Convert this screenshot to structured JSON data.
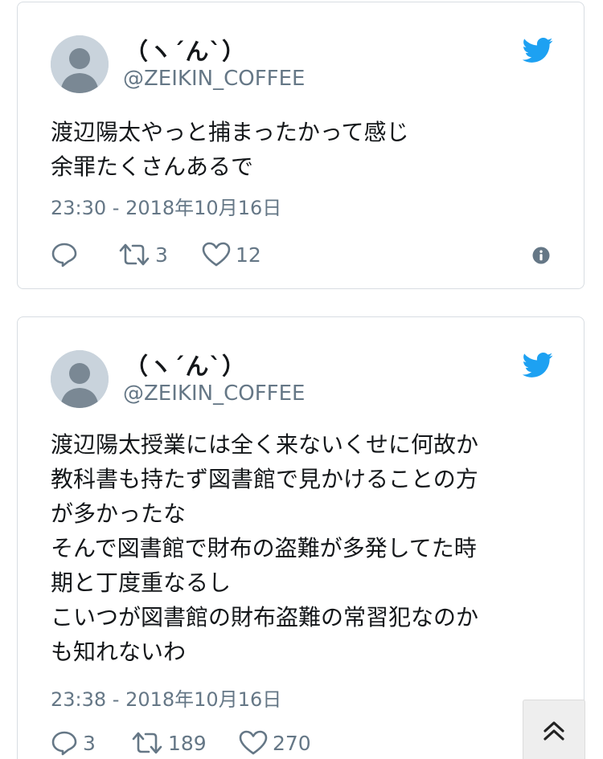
{
  "colors": {
    "twitter_blue": "#1da1f2",
    "secondary_text": "#657786",
    "primary_text": "#14171a",
    "card_border": "#d8dde2"
  },
  "tweets": [
    {
      "author": {
        "display_name": "（ヽ´ん`）",
        "handle": "@ZEIKIN_COFFEE"
      },
      "text": "渡辺陽太やっと捕まったかって感じ\n余罪たくさんあるで",
      "timestamp": "23:30 - 2018年10月16日",
      "reply_count": "",
      "retweet_count": "3",
      "like_count": "12",
      "icons": [
        "avatar-placeholder",
        "twitter-bird-icon",
        "reply-icon",
        "retweet-icon",
        "heart-icon",
        "info-icon"
      ]
    },
    {
      "author": {
        "display_name": "（ヽ´ん`）",
        "handle": "@ZEIKIN_COFFEE"
      },
      "text": "渡辺陽太授業には全く来ないくせに何故か\n教科書も持たず図書館で見かけることの方\nが多かったな\nそんで図書館で財布の盗難が多発してた時\n期と丁度重なるし\nこいつが図書館の財布盗難の常習犯なのか\nも知れないわ",
      "timestamp": "23:38 - 2018年10月16日",
      "reply_count": "3",
      "retweet_count": "189",
      "like_count": "270",
      "icons": [
        "avatar-placeholder",
        "twitter-bird-icon",
        "reply-icon",
        "retweet-icon",
        "heart-icon"
      ]
    }
  ],
  "scroll_to_top": {
    "icon": "double-chevron-up-icon"
  }
}
